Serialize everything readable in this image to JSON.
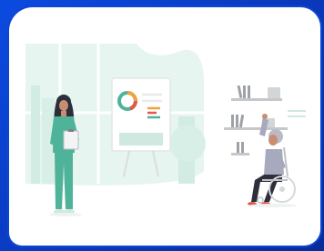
{
  "scene": {
    "description_hidden": "",
    "colors": {
      "frame_blue": "#0b4be0",
      "card_white": "#ffffff",
      "window_mint": "#e3f3ee",
      "teal": "#4fb39a",
      "scrubs": "#4fb39a",
      "hair_dark": "#2c2f3a",
      "skin": "#c98d74",
      "grey_shirt": "#a7a9bd",
      "pants_dark": "#2d2f3b",
      "chart_orange": "#f0a33c",
      "chart_red": "#e2574c",
      "chart_green": "#4fb39a",
      "shelf_grey": "#9ea2a6"
    },
    "icons": [
      "doctor-figure",
      "presentation-board-icon",
      "donut-chart-icon",
      "bookshelf-icon",
      "wheelchair-icon",
      "patient-figure"
    ]
  }
}
